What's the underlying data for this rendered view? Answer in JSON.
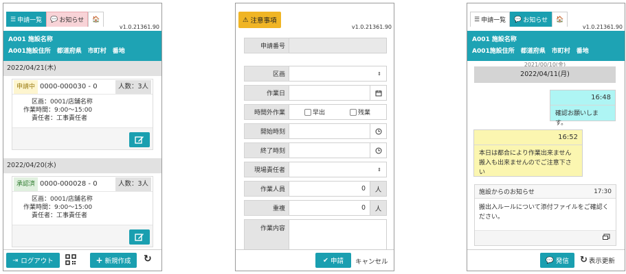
{
  "version": "v1.0.21361.90",
  "tabs": {
    "list": "申請一覧",
    "notice": "お知らせ"
  },
  "facility": {
    "name": "A001 施設名称",
    "address": [
      "A001施設住所",
      "都道府県",
      "市町村",
      "番地"
    ]
  },
  "list": {
    "groups": [
      {
        "date": "2022/04/21(木)",
        "status": "申請中",
        "number": "0000-000030 - 0",
        "people": "人数：3人",
        "area": "区画：0001/店舗名称",
        "time": "作業時間：9:00〜15:00",
        "manager": "責任者：工事責任者"
      },
      {
        "date": "2022/04/20(水)",
        "status": "承認済",
        "number": "0000-000028 - 0",
        "people": "人数：3人",
        "area": "区画：0001/店舗名称",
        "time": "作業時間：9:00〜15:00",
        "manager": "責任者：工事責任者"
      }
    ],
    "logout_label": "ログアウト",
    "new_label": "新規作成"
  },
  "form": {
    "warning_label": "注意事項",
    "fields": {
      "app_no": "申請番号",
      "area": "区画",
      "work_date": "作業日",
      "overtime": "時間外作業",
      "early": "早出",
      "late": "残業",
      "start": "開始時刻",
      "end": "終了時刻",
      "site_manager": "現場責任者",
      "workers": "作業人員",
      "duplicate": "重複",
      "content": "作業内容"
    },
    "workers_value": "0",
    "workers_unit": "人",
    "duplicate_value": "0",
    "duplicate_unit": "人",
    "submit_label": "申請",
    "cancel_label": "キャンセル"
  },
  "chat": {
    "ghost_date": "2021/00/10(金)",
    "date": "2022/04/11(月)",
    "msg1_time": "16:48",
    "msg1_body": "確認お願いします。",
    "msg2_time": "16:52",
    "msg2_line1": "本日は都合により作業出来ません",
    "msg2_line2": "搬入も出来ませんのでご注意下さい",
    "notice_title": "施設からのお知らせ",
    "notice_time": "17:30",
    "notice_line1": "搬出入ルールについて添付ファイルをご確認く",
    "notice_line2": "ださい。",
    "send_label": "発信",
    "refresh_label": "表示更新"
  },
  "colors": {
    "accent": "#1ea3b4",
    "warning": "#f0b524",
    "bubble_mine": "#aef5f4",
    "bubble_theirs": "#fbf6b0"
  }
}
